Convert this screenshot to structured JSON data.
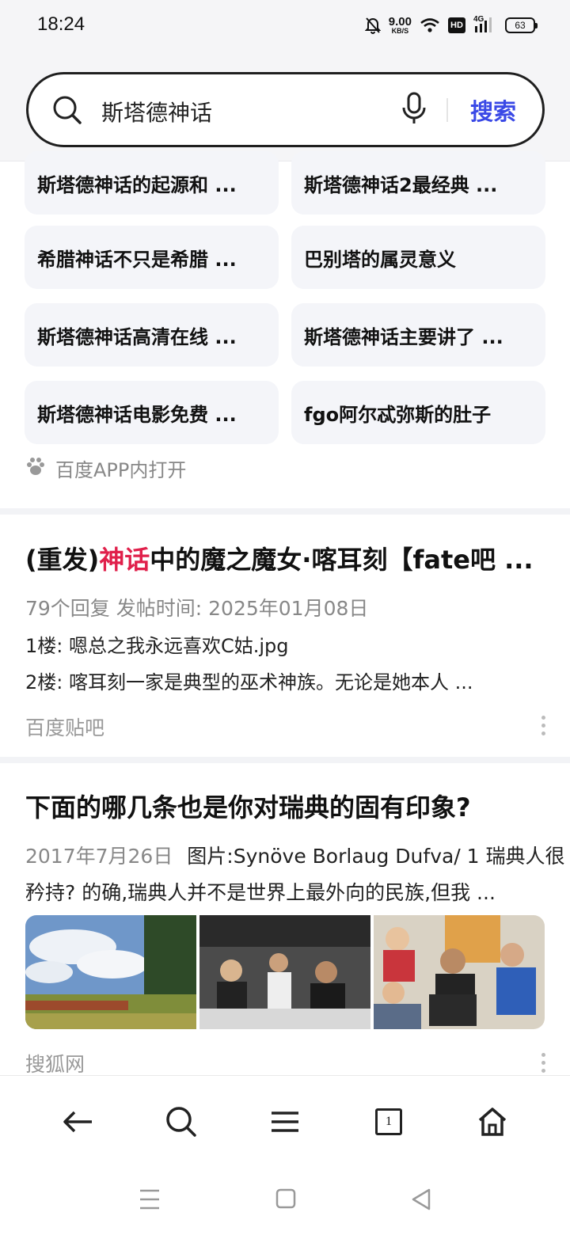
{
  "status_bar": {
    "time": "18:24",
    "net_speed_value": "9.00",
    "net_speed_unit": "KB/S",
    "hd_label": "HD",
    "network_label": "4G",
    "battery": "63",
    "icons": [
      "mute-bell-icon",
      "wifi-icon",
      "signal-icon",
      "battery-icon"
    ]
  },
  "search": {
    "query": "斯塔德神话",
    "button_label": "搜索",
    "accent_color": "#3a49e6"
  },
  "related": {
    "items": [
      "斯塔德神话的起源和 ...",
      "斯塔德神话2最经典 ...",
      "希腊神话不只是希腊 ...",
      "巴别塔的属灵意义",
      "斯塔德神话高清在线 ...",
      "斯塔德神话主要讲了 ...",
      "斯塔德神话电影免费 ...",
      "fgo阿尔忒弥斯的肚子"
    ],
    "open_in_app": "百度APP内打开"
  },
  "results": [
    {
      "title_pre": "(重发)",
      "title_highlight": "神话",
      "title_post": "中的魔之魔女·喀耳刻【fate吧 ...",
      "meta": "79个回复  发帖时间: 2025年01月08日",
      "lines": [
        "1楼: 嗯总之我永远喜欢C姑.jpg",
        "2楼: 喀耳刻一家是典型的巫术神族。无论是她本人 ..."
      ],
      "source": "百度贴吧"
    },
    {
      "title": "下面的哪几条也是你对瑞典的固有印象?",
      "meta_date": "2017年7月26日",
      "snippet_1": "图片:Synöve Borlaug Dufva/ 1 瑞典人很",
      "snippet_2": "矜持? 的确,瑞典人并不是世界上最外向的民族,但我 ...",
      "source": "搜狐网"
    }
  ],
  "bottom_nav": {
    "tab_count": "1",
    "icons": [
      "back-arrow-icon",
      "search-icon",
      "menu-icon",
      "tabs-icon",
      "home-icon"
    ]
  }
}
